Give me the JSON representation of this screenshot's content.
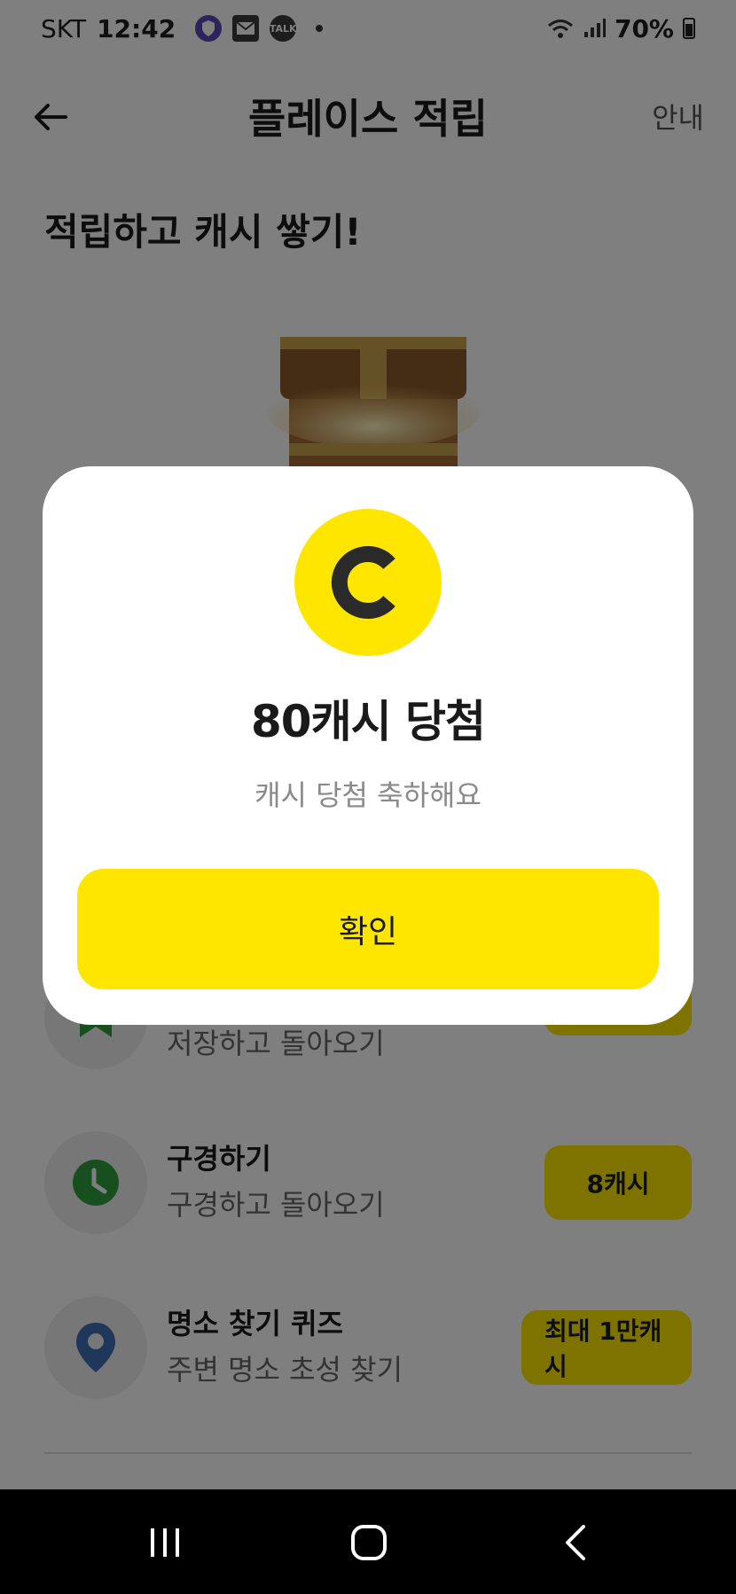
{
  "status_bar": {
    "carrier": "SKT",
    "time": "12:42",
    "notification_icons": [
      "shield-icon",
      "mail-icon",
      "kakaotalk-icon"
    ],
    "notification_talk_label": "TALK",
    "battery": "70%"
  },
  "header": {
    "title": "플레이스 적립",
    "info_label": "안내"
  },
  "headline": "적립하고 캐시 쌓기!",
  "tasks": [
    {
      "title": "",
      "subtitle": "저장하고 돌아오기",
      "icon": "star-icon",
      "button": ""
    },
    {
      "title": "구경하기",
      "subtitle": "구경하고 돌아오기",
      "icon": "clock-icon",
      "button": "8캐시"
    },
    {
      "title": "명소 찾기 퀴즈",
      "subtitle": "주변 명소 초성 찾기",
      "icon": "location-pin-icon",
      "button": "최대 1만캐시"
    }
  ],
  "modal": {
    "coin_letter": "C",
    "title": "80캐시 당첨",
    "subtitle": "캐시 당첨 축하해요",
    "confirm_label": "확인"
  },
  "colors": {
    "accent": "#ffe600",
    "overlay": "rgba(0,0,0,0.5)",
    "clock_green": "#2e9e3e",
    "pin_blue": "#3d6fb6",
    "star_green": "#2e9e3e"
  }
}
